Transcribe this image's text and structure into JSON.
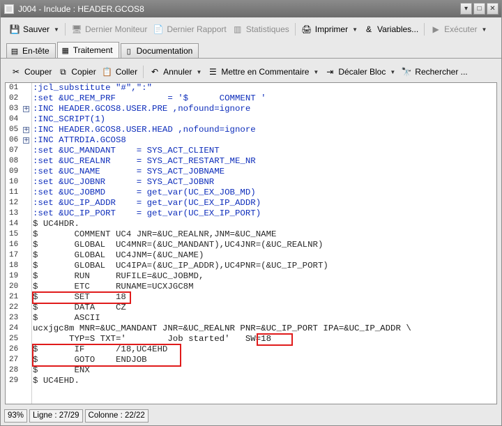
{
  "window": {
    "title": "J004 - Include : HEADER.GCOS8",
    "minimize": "▾",
    "maximize": "□",
    "close": "✕"
  },
  "toolbar": {
    "items": [
      {
        "label": "Sauver",
        "icon": "save-icon",
        "glyph": "💾",
        "dropdown": true,
        "disabled": false
      },
      {
        "label": "Dernier Moniteur",
        "icon": "monitor-icon",
        "glyph": "🖥",
        "dropdown": false,
        "disabled": true
      },
      {
        "label": "Dernier Rapport",
        "icon": "report-icon",
        "glyph": "📄",
        "dropdown": false,
        "disabled": true
      },
      {
        "label": "Statistiques",
        "icon": "chart-icon",
        "glyph": "▥",
        "dropdown": false,
        "disabled": true
      },
      {
        "label": "Imprimer",
        "icon": "printer-icon",
        "glyph": "🖨",
        "dropdown": true,
        "disabled": false
      },
      {
        "label": "Variables...",
        "icon": "variables-icon",
        "glyph": "&",
        "dropdown": false,
        "disabled": false
      },
      {
        "label": "Exécuter",
        "icon": "play-icon",
        "glyph": "▶",
        "dropdown": true,
        "disabled": true
      }
    ]
  },
  "tabs": [
    {
      "label": "En-tête",
      "icon": "header-tab-icon",
      "glyph": "▤",
      "active": false
    },
    {
      "label": "Traitement",
      "icon": "process-tab-icon",
      "glyph": "▦",
      "active": true
    },
    {
      "label": "Documentation",
      "icon": "documentation-tab-icon",
      "glyph": "▯",
      "active": false
    }
  ],
  "edit_toolbar": {
    "items": [
      {
        "label": "Couper",
        "icon": "scissors-icon",
        "glyph": "✂",
        "dropdown": false
      },
      {
        "label": "Copier",
        "icon": "copy-icon",
        "glyph": "⧉",
        "dropdown": false
      },
      {
        "label": "Coller",
        "icon": "paste-icon",
        "glyph": "📋",
        "dropdown": false
      },
      {
        "label": "Annuler",
        "icon": "undo-icon",
        "glyph": "↶",
        "dropdown": true
      },
      {
        "label": "Mettre en Commentaire",
        "icon": "comment-icon",
        "glyph": "☰",
        "dropdown": true
      },
      {
        "label": "Décaler Bloc",
        "icon": "indent-icon",
        "glyph": "⇥",
        "dropdown": true
      },
      {
        "label": "Rechercher ...",
        "icon": "binoculars-icon",
        "glyph": "🔭",
        "dropdown": false
      }
    ]
  },
  "editor": {
    "lines": [
      {
        "num": "01",
        "fold": false,
        "text": ":jcl_substitute \"#\",\":\""
      },
      {
        "num": "02",
        "fold": false,
        "text": ":set &UC_REM_PRF          = '$      COMMENT '"
      },
      {
        "num": "03",
        "fold": true,
        "text": ":INC HEADER.GCOS8.USER.PRE ,nofound=ignore"
      },
      {
        "num": "04",
        "fold": false,
        "text": ":INC_SCRIPT(1)"
      },
      {
        "num": "05",
        "fold": true,
        "text": ":INC HEADER.GCOS8.USER.HEAD ,nofound=ignore"
      },
      {
        "num": "06",
        "fold": true,
        "text": ":INC ATTRDIA.GCOS8"
      },
      {
        "num": "07",
        "fold": false,
        "text": ":set &UC_MANDANT    = SYS_ACT_CLIENT"
      },
      {
        "num": "08",
        "fold": false,
        "text": ":set &UC_REALNR     = SYS_ACT_RESTART_ME_NR"
      },
      {
        "num": "09",
        "fold": false,
        "text": ":set &UC_NAME       = SYS_ACT_JOBNAME"
      },
      {
        "num": "10",
        "fold": false,
        "text": ":set &UC_JOBNR      = SYS_ACT_JOBNR"
      },
      {
        "num": "11",
        "fold": false,
        "text": ":set &UC_JOBMD      = get_var(UC_EX_JOB_MD)"
      },
      {
        "num": "12",
        "fold": false,
        "text": ":set &UC_IP_ADDR    = get_var(UC_EX_IP_ADDR)"
      },
      {
        "num": "13",
        "fold": false,
        "text": ":set &UC_IP_PORT    = get_var(UC_EX_IP_PORT)"
      },
      {
        "num": "14",
        "fold": false,
        "text": "$ UC4HDR."
      },
      {
        "num": "15",
        "fold": false,
        "text": "$       COMMENT UC4 JNR=&UC_REALNR,JNM=&UC_NAME"
      },
      {
        "num": "16",
        "fold": false,
        "text": "$       GLOBAL  UC4MNR=(&UC_MANDANT),UC4JNR=(&UC_REALNR)"
      },
      {
        "num": "17",
        "fold": false,
        "text": "$       GLOBAL  UC4JNM=(&UC_NAME)"
      },
      {
        "num": "18",
        "fold": false,
        "text": "$       GLOBAL  UC4IPA=(&UC_IP_ADDR),UC4PNR=(&UC_IP_PORT)"
      },
      {
        "num": "19",
        "fold": false,
        "text": "$       RUN     RUFILE=&UC_JOBMD,"
      },
      {
        "num": "20",
        "fold": false,
        "text": "$       ETC     RUNAME=UCXJGC8M"
      },
      {
        "num": "21",
        "fold": false,
        "text": "$       SET     18"
      },
      {
        "num": "22",
        "fold": false,
        "text": "$       DATA    CZ"
      },
      {
        "num": "23",
        "fold": false,
        "text": "$       ASCII"
      },
      {
        "num": "24",
        "fold": false,
        "text": "ucxjgc8m MNR=&UC_MANDANT JNR=&UC_REALNR PNR=&UC_IP_PORT IPA=&UC_IP_ADDR \\"
      },
      {
        "num": "25",
        "fold": false,
        "text": "       TYP=S TXT='        Job started'   SW=18"
      },
      {
        "num": "26",
        "fold": false,
        "text": "$       IF      /18,UC4EHD"
      },
      {
        "num": "27",
        "fold": false,
        "text": "$       GOTO    ENDJOB"
      },
      {
        "num": "28",
        "fold": false,
        "text": "$       ENX"
      },
      {
        "num": "29",
        "fold": false,
        "text": "$ UC4EHD."
      }
    ]
  },
  "colors": {
    "keyword": "#0d2dbb",
    "value": "#c21807",
    "dollar": "#8b4513",
    "highlight": "#e01b1b"
  },
  "statusbar": {
    "zoom": "93%",
    "line": "Ligne : 27/29",
    "column": "Colonne : 22/22"
  }
}
